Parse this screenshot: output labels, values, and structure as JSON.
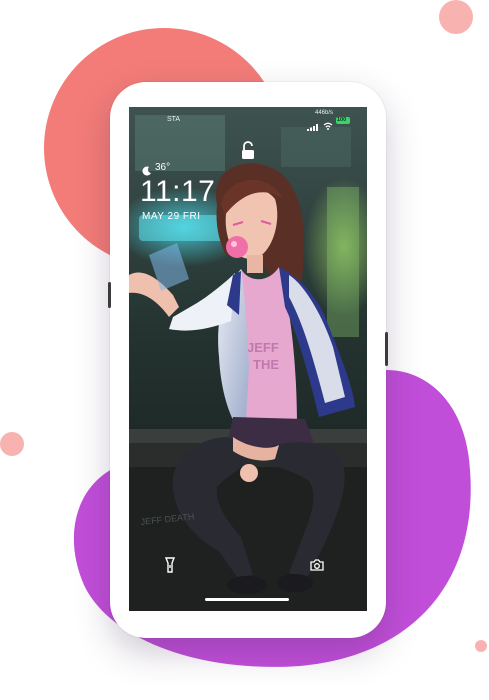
{
  "lockscreen": {
    "carrier": "STA",
    "speed": "446b/s",
    "battery": "100",
    "weather_temp": "36°",
    "time": "11:17",
    "date": "MAY 29 FRI",
    "shirt_text_line1": "JEFF",
    "shirt_text_line2": "THE",
    "wall_text": "JEFF DEATH"
  },
  "icons": {
    "unlock": "unlock-icon",
    "weather": "moon-icon",
    "flashlight": "flashlight-icon",
    "camera": "camera-icon",
    "signal": "signal-icon",
    "wifi": "wifi-icon"
  },
  "colors": {
    "coral_blob": "#f37c78",
    "purple_blob": "#c14ed9",
    "pink_dot": "#f8b2b0",
    "battery": "#39d36a"
  }
}
